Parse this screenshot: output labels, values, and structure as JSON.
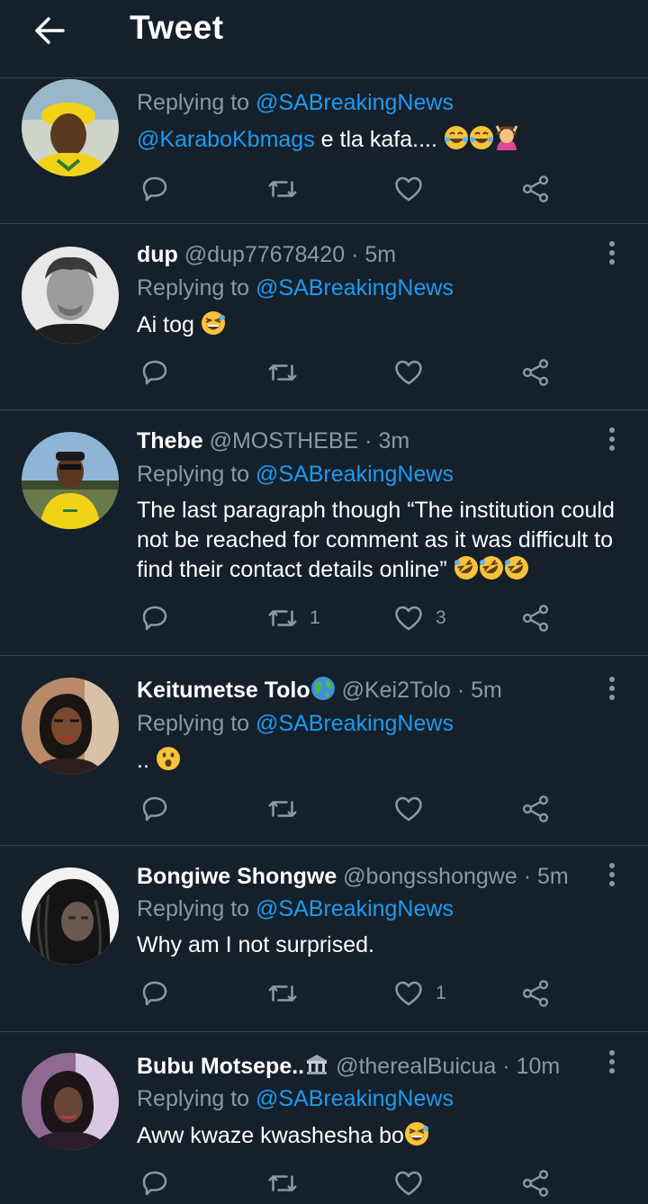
{
  "header": {
    "title": "Tweet"
  },
  "colors": {
    "background": "#15202b",
    "muted": "#8b98a5",
    "link": "#1d9bf0",
    "divider": "#38444d"
  },
  "tweets": [
    {
      "display_name": "",
      "handle": "",
      "time": "",
      "replying_prefix": "Replying to",
      "replying_handle": "@SABreakingNews",
      "mention": "@KaraboKbmags",
      "text": "e tla kafa....",
      "emoji": [
        "face-with-tears-of-joy",
        "face-with-tears-of-joy",
        "woman-gesturing-ok"
      ],
      "retweets": "",
      "likes": ""
    },
    {
      "display_name": "dup",
      "handle": "@dup77678420",
      "time": "· 5m",
      "replying_prefix": "Replying to",
      "replying_handle": "@SABreakingNews",
      "text": "Ai tog",
      "emoji": [
        "grinning-squinting-face"
      ],
      "retweets": "",
      "likes": ""
    },
    {
      "display_name": "Thebe",
      "handle": "@MOSTHEBE",
      "time": "· 3m",
      "replying_prefix": "Replying to",
      "replying_handle": "@SABreakingNews",
      "text": "The last paragraph though “The institution could not be reached for comment as it was difficult to find their contact details online”",
      "emoji": [
        "rolling-on-floor-laughing",
        "rolling-on-floor-laughing",
        "rolling-on-floor-laughing"
      ],
      "retweets": "1",
      "likes": "3"
    },
    {
      "display_name": "Keitumetse Tolo",
      "handle": "@Kei2Tolo",
      "time": "· 5m",
      "replying_prefix": "Replying to",
      "replying_handle": "@SABreakingNews",
      "text": "..",
      "emoji": [
        "hushed-face"
      ],
      "retweets": "",
      "likes": ""
    },
    {
      "display_name": "Bongiwe Shongwe",
      "handle": "@bongsshongwe",
      "time": "· 5m",
      "replying_prefix": "Replying to",
      "replying_handle": "@SABreakingNews",
      "text": "Why am I not surprised.",
      "retweets": "",
      "likes": "1"
    },
    {
      "display_name": "Bubu Motsepe..",
      "handle": "@therealBuicua",
      "time": "· 10m",
      "replying_prefix": "Replying to",
      "replying_handle": "@SABreakingNews",
      "text": "Aww kwaze kwashesha bo",
      "emoji": [
        "grinning-squinting-face"
      ],
      "retweets": "",
      "likes": ""
    }
  ],
  "icons": {
    "back": "arrow-left-icon",
    "more": "vertical-ellipsis-icon",
    "reply": "reply-bubble-icon",
    "retweet": "retweet-icon",
    "like": "heart-icon",
    "share": "share-icon",
    "globe": "globe-emoji-icon",
    "bank": "bank-emoji-icon"
  }
}
